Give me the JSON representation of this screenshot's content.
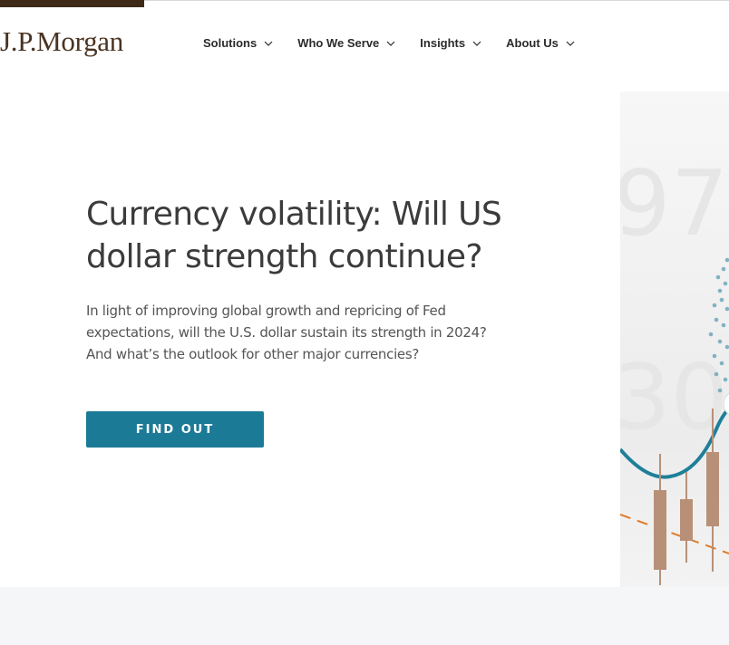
{
  "brand": {
    "logo_text": "J.P.Morgan"
  },
  "nav": {
    "items": [
      {
        "label": "Solutions"
      },
      {
        "label": "Who We Serve"
      },
      {
        "label": "Insights"
      },
      {
        "label": "About Us"
      }
    ]
  },
  "hero": {
    "title": "Currency volatility: Will US dollar strength continue?",
    "description": "In light of improving global growth and repricing of Fed expectations, will the U.S. dollar sustain its strength in 2024? And what’s the outlook for other major currencies?",
    "cta_label": "FIND OUT",
    "image_digits": [
      "97",
      "30"
    ]
  },
  "colors": {
    "brand_brown": "#3f2a17",
    "cta_teal": "#1b7a96",
    "candle": "#b89078",
    "trend_line": "#e07b2a"
  }
}
